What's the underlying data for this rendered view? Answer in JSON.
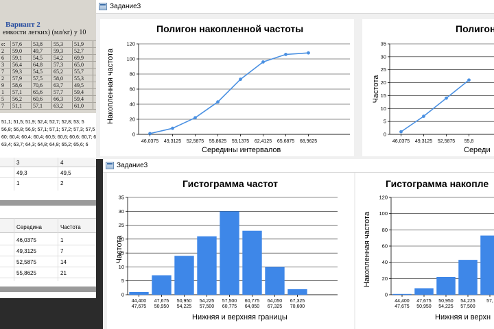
{
  "photo": {
    "heading": "Вариант 2",
    "subtitle": "емкости легких) (мл/кг) у 10",
    "row_label_fragments": [
      "е:",
      "2",
      "6",
      "3",
      "7",
      "2",
      "9",
      "1",
      "5",
      "7"
    ],
    "grid": [
      [
        "57,6",
        "53,8",
        "55,3",
        "51,9"
      ],
      [
        "59,0",
        "49,7",
        "59,3",
        "52,7"
      ],
      [
        "59,1",
        "54,5",
        "54,2",
        "69,9"
      ],
      [
        "56,4",
        "64,8",
        "57,3",
        "65,0"
      ],
      [
        "59,3",
        "54,5",
        "65,2",
        "55,7"
      ],
      [
        "57,9",
        "57,5",
        "58,0",
        "55,3"
      ],
      [
        "58,6",
        "70,6",
        "63,7",
        "49,5"
      ],
      [
        "57,1",
        "65,6",
        "57,7",
        "59,4"
      ],
      [
        "56,2",
        "60,6",
        "66,3",
        "59,4"
      ],
      [
        "51,1",
        "57,1",
        "63,2",
        "61,0"
      ]
    ]
  },
  "data_text": {
    "lines": [
      "51,1; 51,5; 51,9; 52,4; 52,7; 52,8; 53; 5",
      "56,8; 56,8; 56,9; 57,1; 57,1; 57,2; 57,3; 57,5",
      "60; 60,4; 60,4; 60,4; 60,5; 60,6; 60,6; 60,7; 6",
      "63,4; 63,7; 64,3; 64,8; 64,8; 65,2; 65,6; 6"
    ]
  },
  "grid1": {
    "col3": "3",
    "col4": "4",
    "row1": [
      "49,3",
      "49,5"
    ],
    "row2": [
      "1",
      "2"
    ]
  },
  "grid2": {
    "headers": [
      "Середина",
      "Частота"
    ],
    "rows": [
      [
        "46,0375",
        "1"
      ],
      [
        "49,3125",
        "7"
      ],
      [
        "52,5875",
        "14"
      ],
      [
        "55,8625",
        "21"
      ]
    ]
  },
  "window_back": {
    "title": "Задание3",
    "chart1_title": "Полигон накопленной частоты",
    "chart1_ylabel": "Накопленная частота",
    "chart1_xlabel": "Середины интервалов",
    "chart2_title": "Полигон",
    "chart2_ylabel": "Частота",
    "chart2_xlabel": "Середи"
  },
  "window_front": {
    "title": "Задание3",
    "chart3_title": "Гистограмма частот",
    "chart3_ylabel": "Частота",
    "chart3_xlabel": "Нижняя и верхняя границы",
    "chart4_title": "Гистограмма накопле",
    "chart4_ylabel": "Накопленная частота",
    "chart4_xlabel": "Нижняя и верхн"
  },
  "colors": {
    "series": "#4a90e2",
    "bar": "#3e87e8"
  },
  "chart_data": [
    {
      "type": "line",
      "title": "Полигон накопленной частоты",
      "xlabel": "Середины интервалов",
      "ylabel": "Накопленная частота",
      "categories": [
        "46,0375",
        "49,3125",
        "52,5875",
        "55,8625",
        "59,1375",
        "62,4125",
        "65,6875",
        "68,9625"
      ],
      "values": [
        1,
        8,
        22,
        43,
        73,
        96,
        106,
        108
      ],
      "ylim": [
        0,
        120
      ],
      "yticks": [
        0,
        20,
        40,
        60,
        80,
        100,
        120
      ],
      "grid": true
    },
    {
      "type": "line",
      "title": "Полигон",
      "xlabel": "Середи",
      "ylabel": "Частота",
      "categories": [
        "46,0375",
        "49,3125",
        "52,5875",
        "55,8"
      ],
      "values": [
        1,
        7,
        14,
        21
      ],
      "ylim": [
        0,
        35
      ],
      "yticks": [
        0,
        5,
        10,
        15,
        20,
        25,
        30,
        35
      ],
      "grid": true
    },
    {
      "type": "bar",
      "title": "Гистограмма частот",
      "xlabel": "Нижняя и верхняя границы",
      "ylabel": "Частота",
      "categories": [
        [
          "44,400",
          "47,675"
        ],
        [
          "47,675",
          "50,950"
        ],
        [
          "50,950",
          "54,225"
        ],
        [
          "54,225",
          "57,500"
        ],
        [
          "57,500",
          "60,775"
        ],
        [
          "60,775",
          "64,050"
        ],
        [
          "64,050",
          "67,325"
        ],
        [
          "67,325",
          "70,600"
        ]
      ],
      "values": [
        1,
        7,
        14,
        21,
        30,
        23,
        10,
        2
      ],
      "ylim": [
        0,
        35
      ],
      "yticks": [
        0,
        5,
        10,
        15,
        20,
        25,
        30,
        35
      ],
      "grid": true
    },
    {
      "type": "bar",
      "title": "Гистограмма накопле",
      "xlabel": "Нижняя и верхн",
      "ylabel": "Накопленная частота",
      "categories": [
        [
          "44,400",
          "47,675"
        ],
        [
          "47,675",
          "50,950"
        ],
        [
          "50,950",
          "54,225"
        ],
        [
          "54,225",
          "57,500"
        ],
        [
          "57,"
        ]
      ],
      "values": [
        1,
        8,
        22,
        43,
        73
      ],
      "ylim": [
        0,
        120
      ],
      "yticks": [
        0,
        20,
        40,
        60,
        80,
        100,
        120
      ],
      "grid": true
    }
  ]
}
